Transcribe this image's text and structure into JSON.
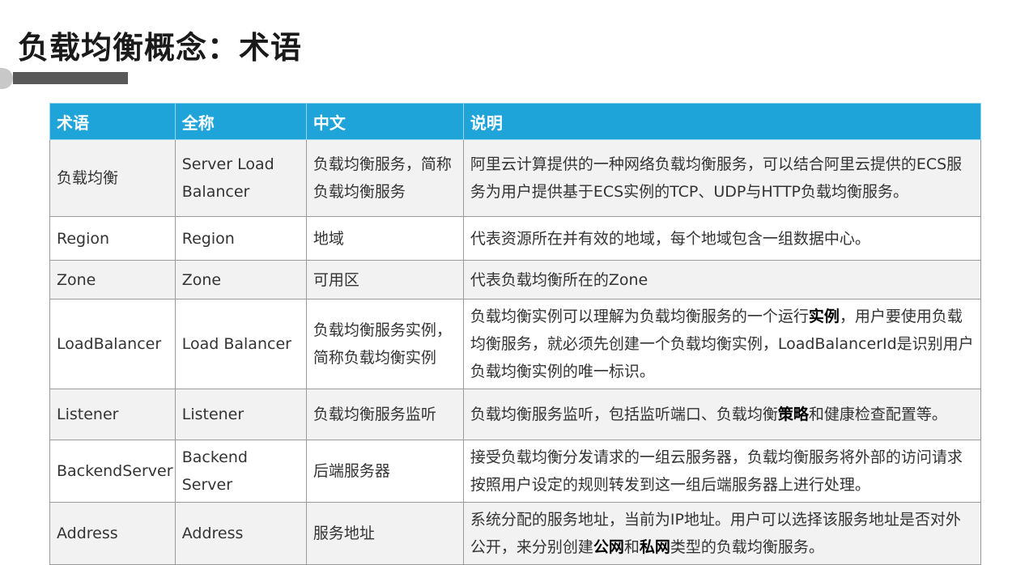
{
  "page": {
    "title": "负载均衡概念：术语"
  },
  "table": {
    "headers": [
      "术语",
      "全称",
      "中文",
      "说明"
    ],
    "rows": [
      {
        "term": "负载均衡",
        "full": "Server Load Balancer",
        "cn": "负载均衡服务，简称负载均衡服务",
        "desc": [
          {
            "t": "阿里云计算提供的一种网络负载均衡服务，可以结合阿里云提供的ECS服务为用户提供基于ECS实例的TCP、UDP与HTTP负载均衡服务。",
            "b": false
          }
        ]
      },
      {
        "term": "Region",
        "full": "Region",
        "cn": "地域",
        "desc": [
          {
            "t": "代表资源所在并有效的地域，每个地域包含一组数据中心。",
            "b": false
          }
        ]
      },
      {
        "term": "Zone",
        "full": "Zone",
        "cn": "可用区",
        "desc": [
          {
            "t": "代表负载均衡所在的Zone",
            "b": false
          }
        ]
      },
      {
        "term": "LoadBalancer",
        "full": "Load Balancer",
        "cn": "负载均衡服务实例，简称负载均衡实例",
        "desc": [
          {
            "t": "负载均衡实例可以理解为负载均衡服务的一个运行",
            "b": false
          },
          {
            "t": "实例",
            "b": true
          },
          {
            "t": "，用户要使用负载均衡服务，就必须先创建一个负载均衡实例，LoadBalancerId是识别用户负载均衡实例的唯一标识。",
            "b": false
          }
        ]
      },
      {
        "term": "Listener",
        "full": "Listener",
        "cn": "负载均衡服务监听",
        "desc": [
          {
            "t": "负载均衡服务监听，包括监听端口、负载均衡",
            "b": false
          },
          {
            "t": "策略",
            "b": true
          },
          {
            "t": "和健康检查配置等。",
            "b": false
          }
        ]
      },
      {
        "term": "BackendServer",
        "full": "Backend Server",
        "cn": "后端服务器",
        "desc": [
          {
            "t": "接受负载均衡分发请求的一组云服务器，负载均衡服务将外部的访问请求按照用户设定的规则转发到这一组后端服务器上进行处理。",
            "b": false
          }
        ]
      },
      {
        "term": "Address",
        "full": "Address",
        "cn": "服务地址",
        "desc": [
          {
            "t": "系统分配的服务地址，当前为IP地址。用户可以选择该服务地址是否对外公开，来分别创建",
            "b": false
          },
          {
            "t": "公网",
            "b": true
          },
          {
            "t": "和",
            "b": false
          },
          {
            "t": "私网",
            "b": true
          },
          {
            "t": "类型的负载均衡服务。",
            "b": false
          }
        ]
      }
    ]
  }
}
